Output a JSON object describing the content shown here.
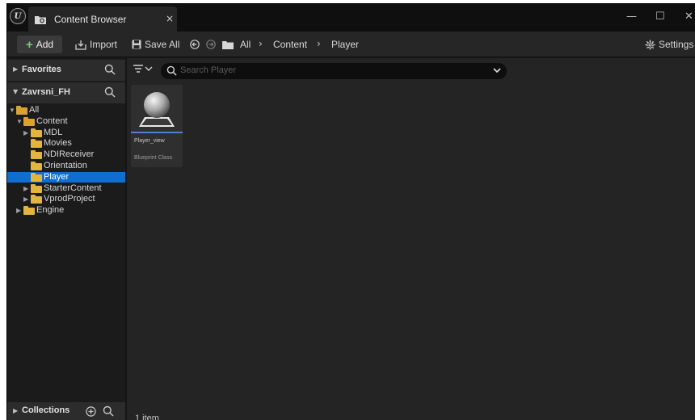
{
  "window": {
    "logo_text": "U",
    "tab_title": "Content Browser",
    "tab_close": "×",
    "minimize": "—",
    "maximize": "☐",
    "close": "✕"
  },
  "toolbar": {
    "add_label": "Add",
    "import_label": "Import",
    "save_all_label": "Save All",
    "breadcrumbs": [
      "All",
      "Content",
      "Player"
    ],
    "settings_label": "Settings"
  },
  "sidebar": {
    "favorites_label": "Favorites",
    "project_label": "Zavrsni_FH",
    "tree": [
      {
        "label": "All",
        "level": 0,
        "expanded": true,
        "selected": false
      },
      {
        "label": "Content",
        "level": 1,
        "expanded": true,
        "selected": false
      },
      {
        "label": "MDL",
        "level": 2,
        "expanded": false,
        "selected": false
      },
      {
        "label": "Movies",
        "level": 2,
        "expanded": null,
        "selected": false
      },
      {
        "label": "NDIReceiver",
        "level": 2,
        "expanded": null,
        "selected": false
      },
      {
        "label": "Orientation",
        "level": 2,
        "expanded": null,
        "selected": false
      },
      {
        "label": "Player",
        "level": 2,
        "expanded": null,
        "selected": true
      },
      {
        "label": "StarterContent",
        "level": 2,
        "expanded": false,
        "selected": false
      },
      {
        "label": "VprodProject",
        "level": 2,
        "expanded": false,
        "selected": false
      },
      {
        "label": "Engine",
        "level": 1,
        "expanded": false,
        "selected": false
      }
    ],
    "collections_label": "Collections"
  },
  "main": {
    "search_placeholder": "Search Player",
    "assets": [
      {
        "name": "Player_view",
        "type": "Blueprint Class"
      }
    ],
    "status": "1 item"
  },
  "colors": {
    "selection": "#0f6fd1",
    "folder": "#e3b53e",
    "add_plus": "#6bd06b",
    "asset_underline": "#4f7fd6"
  }
}
